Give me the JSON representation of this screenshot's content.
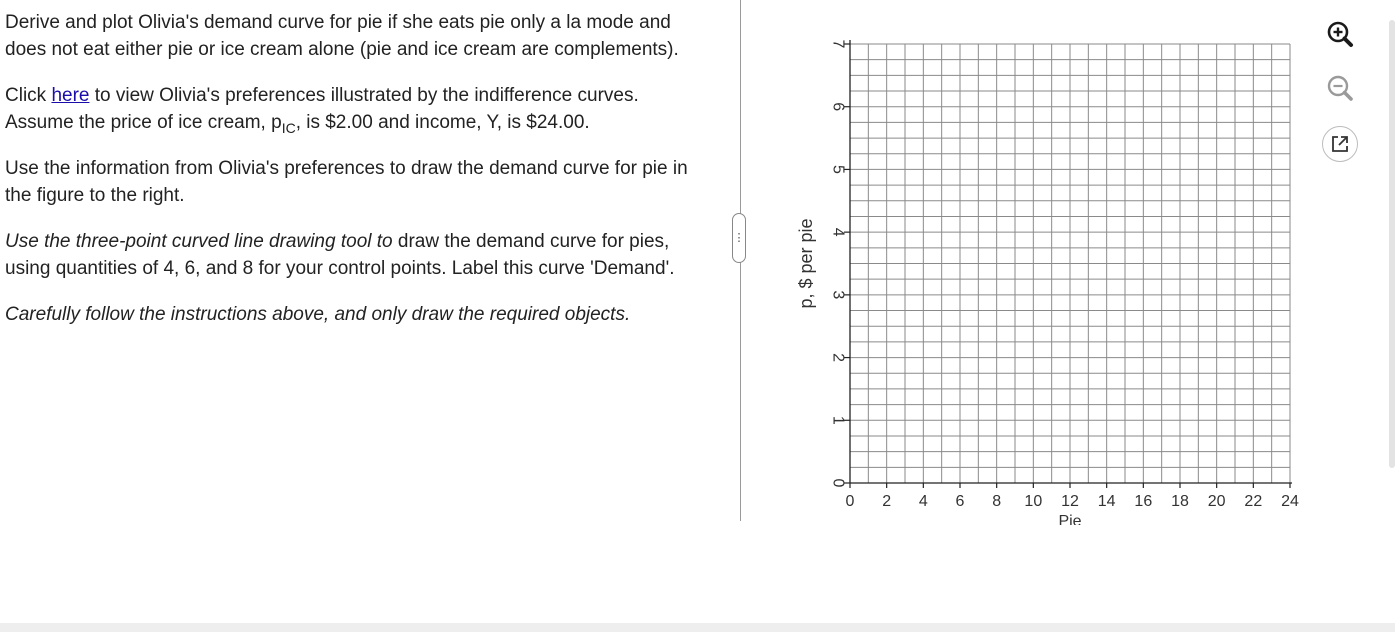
{
  "question": {
    "p1": "Derive and plot Olivia's demand curve for pie if she eats pie only a la mode and does not eat either pie or ice cream alone (pie and ice cream are complements).",
    "p2_before_link": "Click ",
    "p2_link": "here",
    "p2_after_link": " to view Olivia's preferences illustrated by the indifference curves. Assume the price of ice cream, ",
    "p2_price_symbol": "p",
    "p2_price_subscript": "IC",
    "p2_after_price": ", is $2.00 and income, Y, is $24.00.",
    "p3": "Use the information from Olivia's preferences to draw the demand curve for pie in the figure to the right.",
    "p4_italic": "Use the three-point curved line drawing tool to",
    "p4_rest": " draw the demand curve for pies, using quantities of 4, 6, and 8 for your control points. Label this curve 'Demand'.",
    "p5": "Carefully follow the instructions above, and only draw the required objects."
  },
  "splitter": {
    "glyph": "⋮"
  },
  "graph": {
    "ylabel": "p, $ per pie",
    "xlabel": "Pie",
    "y_ticks": [
      "0",
      "1",
      "2",
      "3",
      "4",
      "5",
      "6",
      "7"
    ],
    "x_ticks": [
      "0",
      "2",
      "4",
      "6",
      "8",
      "10",
      "12",
      "14",
      "16",
      "18",
      "20",
      "22",
      "24"
    ],
    "x_range": [
      0,
      24
    ],
    "y_range": [
      0,
      7
    ],
    "grid_step_x": 1,
    "grid_step_y": 0.25
  },
  "toolbar": {
    "zoom_in_icon": "zoom-in-icon",
    "zoom_out_icon": "zoom-out-icon",
    "popout_icon": "external-link-icon"
  },
  "colors": {
    "link": "#1a0dab",
    "grid": "#8a8a8a"
  }
}
